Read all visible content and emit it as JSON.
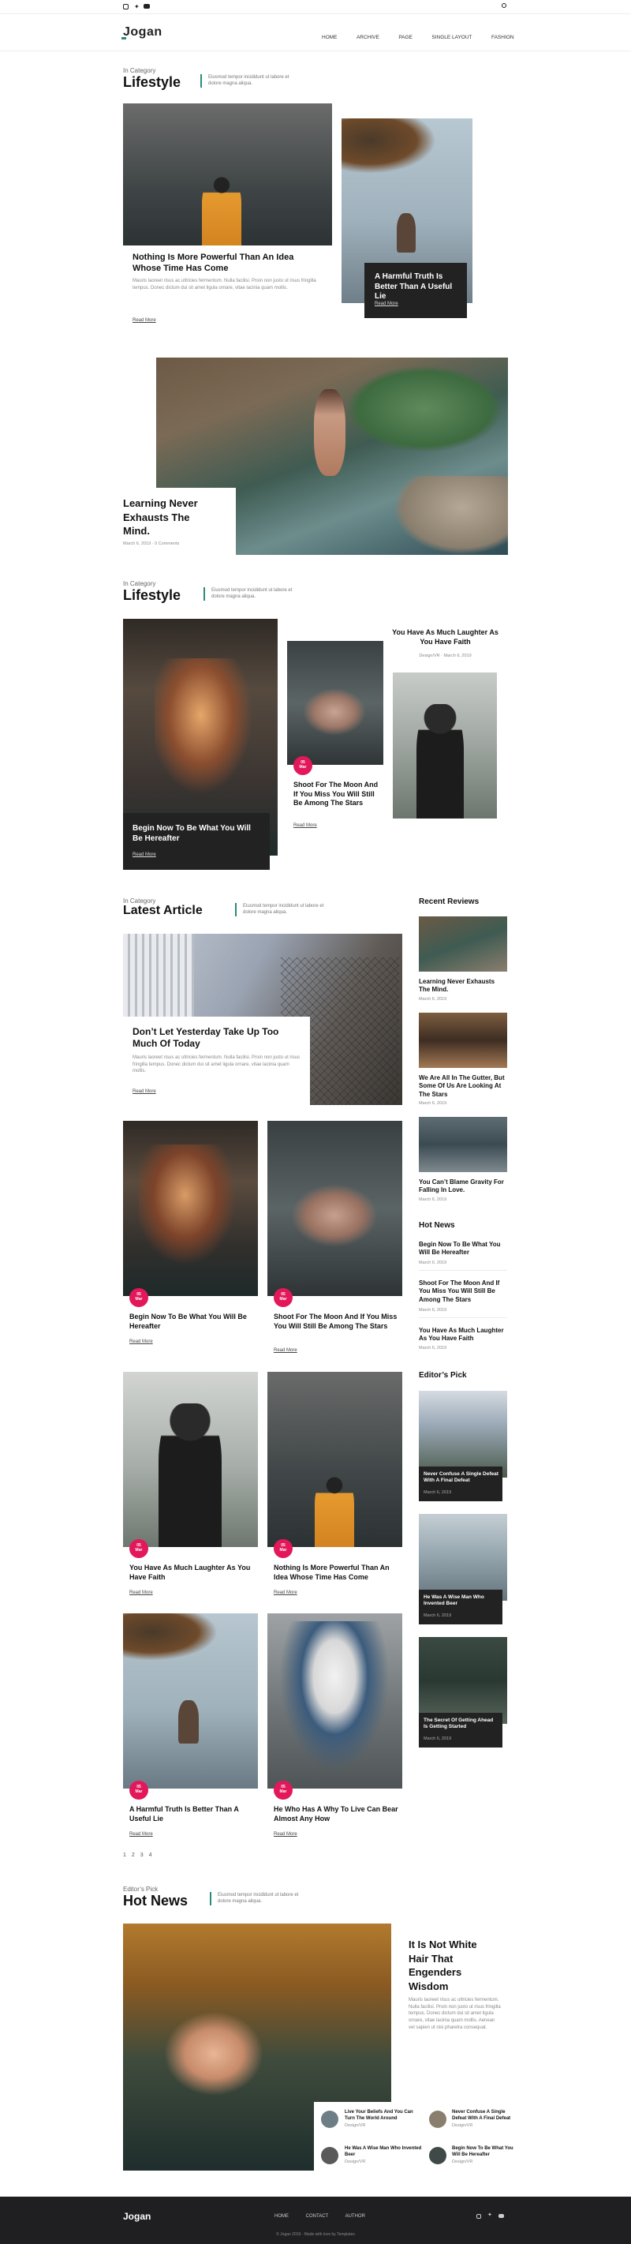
{
  "topbar": {
    "search_icon": "search-icon",
    "social": [
      "instagram-icon",
      "twitter-icon",
      "youtube-icon"
    ]
  },
  "header": {
    "logo": "Jogan",
    "nav": [
      "HOME",
      "ARCHIVE",
      "PAGE",
      "SINGLE LAYOUT",
      "FASHION"
    ]
  },
  "section1": {
    "small": "In Category",
    "title": "Lifestyle",
    "desc": "Eiusmod tempor incididunt ut labore et dolore magna aliqua.",
    "card1": {
      "title": "Nothing Is More Powerful Than An Idea Whose Time Has Come",
      "text": "Mauris laoreet risus ac ultricies fermentum. Nulla facilisi. Proin non justo ut risus fringilla tempus. Donec dictum dui sit amet ligula ornare, vitae lacinia quam mollis.",
      "more": "Read More"
    },
    "card2": {
      "title": "A Harmful Truth Is Better Than A Useful Lie",
      "more": "Read More"
    },
    "card3": {
      "title": "Learning Never Exhausts The Mind.",
      "meta": "March 6, 2019 · 0 Comments"
    }
  },
  "section2": {
    "small": "In Category",
    "title": "Lifestyle",
    "desc": "Eiusmod tempor incididunt ut labore et dolore magna aliqua.",
    "card1": {
      "title": "Begin Now To Be What You Will Be Hereafter",
      "more": "Read More"
    },
    "card2": {
      "badge_day": "05",
      "badge_mon": "Mar",
      "title": "Shoot For The Moon And If You Miss You Will Still Be Among The Stars",
      "more": "Read More"
    },
    "card3": {
      "title": "You Have As Much Laughter As You Have Faith",
      "meta": "Design/VR · March 6, 2019"
    }
  },
  "latest": {
    "small": "In Category",
    "title": "Latest Article",
    "desc": "Eiusmod tempor incididunt ut labore et dolore magna aliqua.",
    "featured": {
      "title": "Don’t Let Yesterday Take Up Too Much Of Today",
      "text": "Mauris laoreet risus ac ultricies fermentum. Nulla facilisi. Proin non justo ut risus fringilla tempus. Donec dictum dui sit amet ligula ornare, vitae lacinia quam mollis.",
      "more": "Read More"
    },
    "grid": [
      {
        "title": "Begin Now To Be What You Will Be Hereafter",
        "more": "Read More",
        "day": "05",
        "mon": "Mar"
      },
      {
        "title": "Shoot For The Moon And If You Miss You Will Still Be Among The Stars",
        "more": "Read More",
        "day": "05",
        "mon": "Mar"
      },
      {
        "title": "You Have As Much Laughter As You Have Faith",
        "more": "Read More",
        "day": "05",
        "mon": "Mar"
      },
      {
        "title": "Nothing Is More Powerful Than An Idea Whose Time Has Come",
        "more": "Read More",
        "day": "05",
        "mon": "Mar"
      },
      {
        "title": "A Harmful Truth Is Better Than A Useful Lie",
        "more": "Read More",
        "day": "05",
        "mon": "Mar"
      },
      {
        "title": "He Who Has A Why To Live Can Bear Almost Any How",
        "more": "Read More",
        "day": "05",
        "mon": "Mar"
      }
    ],
    "pagination": [
      "1",
      "2",
      "3",
      "4"
    ]
  },
  "sidebar": {
    "reviews_title": "Recent Reviews",
    "reviews": [
      {
        "title": "Learning Never Exhausts The Mind.",
        "date": "March 6, 2019"
      },
      {
        "title": "We Are All In The Gutter, But Some Of Us Are Looking At The Stars",
        "date": "March 6, 2019"
      },
      {
        "title": "You Can’t Blame Gravity For Falling In Love.",
        "date": "March 6, 2019"
      }
    ],
    "hot_title": "Hot News",
    "hot": [
      {
        "title": "Begin Now To Be What You Will Be Hereafter",
        "date": "March 6, 2019"
      },
      {
        "title": "Shoot For The Moon And If You Miss You Will Still Be Among The Stars",
        "date": "March 6, 2019"
      },
      {
        "title": "You Have As Much Laughter As You Have Faith",
        "date": "March 6, 2019"
      }
    ],
    "editor_title": "Editor’s Pick",
    "editor": [
      {
        "title": "Never Confuse A Single Defeat With A Final Defeat",
        "date": "March 6, 2019"
      },
      {
        "title": "He Was A Wise Man Who Invented Beer",
        "date": "March 6, 2019"
      },
      {
        "title": "The Secret Of Getting Ahead Is Getting Started",
        "date": "March 6, 2019"
      }
    ]
  },
  "hotnews": {
    "small": "Editor’s Pick",
    "title": "Hot News",
    "desc": "Eiusmod tempor incididunt ut labore et dolore magna aliqua.",
    "main": {
      "title": "It Is Not White Hair That Engenders Wisdom",
      "text": "Mauris laoreet risus ac ultricies fermentum. Nulla facilisi. Proin non justo ut risus fringilla tempus. Donec dictum dui sit amet ligula ornare, vitae lacinia quam mollis. Aenean vel sapien ut nisi pharetra consequat."
    },
    "small_items": [
      {
        "title": "Live Your Beliefs And You Can Turn The World Around",
        "meta": "Design/VR"
      },
      {
        "title": "Never Confuse A Single Defeat With A Final Defeat",
        "meta": "Design/VR"
      },
      {
        "title": "He Was A Wise Man Who Invented Beer",
        "meta": "Design/VR"
      },
      {
        "title": "Begin Now To Be What You Will Be Hereafter",
        "meta": "Design/VR"
      }
    ]
  },
  "footer": {
    "logo": "Jogan",
    "links": [
      "HOME",
      "CONTACT",
      "AUTHOR"
    ],
    "copyright": "© Jogan 2019 - Made with love by Templates"
  }
}
